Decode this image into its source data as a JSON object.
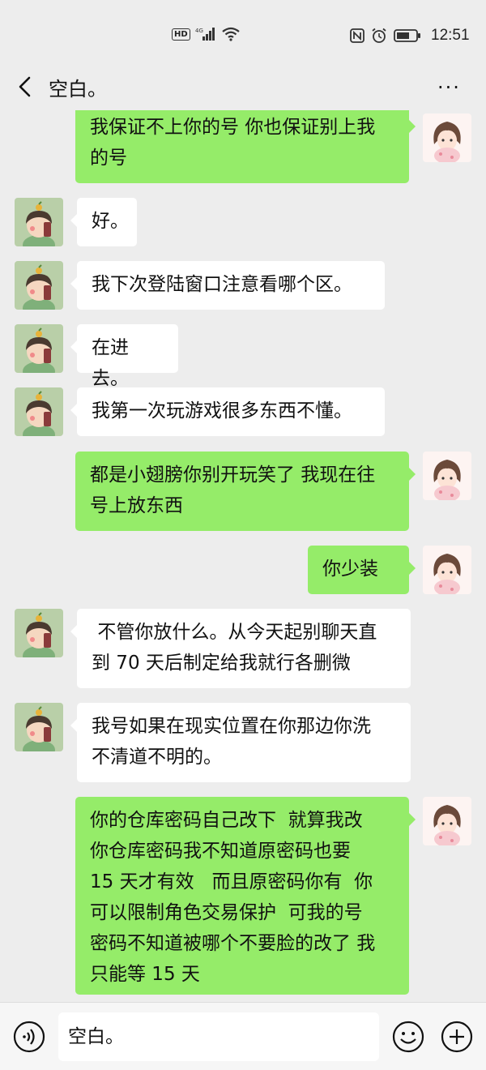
{
  "status_bar": {
    "hd": "HD",
    "network": "4G",
    "time": "12:51"
  },
  "header": {
    "title": "空白。",
    "more": "···"
  },
  "messages": [
    {
      "side": "right",
      "text": "我保证不上你的号 你也保证别上我\n的号"
    },
    {
      "side": "left",
      "text": "好。"
    },
    {
      "side": "left",
      "text": "我下次登陆窗口注意看哪个区。"
    },
    {
      "side": "left",
      "text": "在进去。"
    },
    {
      "side": "left",
      "text": "我第一次玩游戏很多东西不懂。"
    },
    {
      "side": "right",
      "text": "都是小翅膀你别开玩笑了 我现在往\n号上放东西"
    },
    {
      "side": "right",
      "text": "你少装"
    },
    {
      "side": "left",
      "text": " 不管你放什么。从今天起别聊天直\n到 70 天后制定给我就行各删微"
    },
    {
      "side": "left",
      "text": "我号如果在现实位置在你那边你洗\n不清道不明的。"
    },
    {
      "side": "right",
      "text": "你的仓库密码自己改下  就算我改\n你仓库密码我不知道原密码也要\n15 天才有效   而且原密码你有  你\n可以限制角色交易保护  可我的号\n密码不知道被哪个不要脸的改了 我\n只能等 15 天"
    }
  ],
  "input": {
    "value": "空白。"
  },
  "colors": {
    "background": "#ededed",
    "my_bubble": "#95ec69",
    "their_bubble": "#ffffff"
  }
}
